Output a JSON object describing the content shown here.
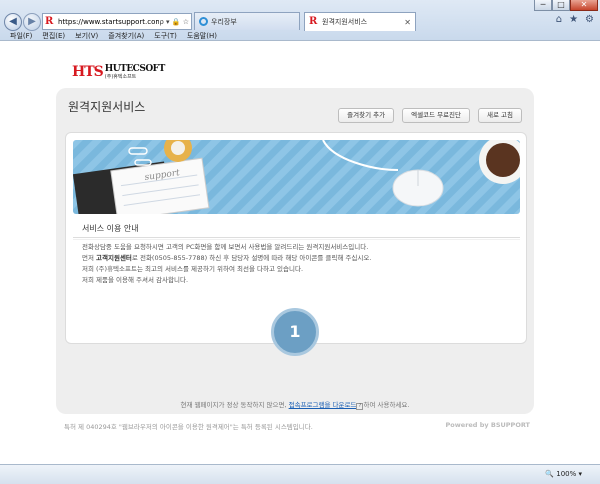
{
  "browser": {
    "window_buttons": {
      "minimize": "─",
      "maximize": "□",
      "close": "✕"
    },
    "back_icon": "back-arrow-icon",
    "forward_icon": "forward-arrow-icon",
    "address": "https://www.startsupport.com",
    "address_icons": "ρ ▾ 🔒 ☆",
    "tabs": [
      {
        "label": "우리장부",
        "active": false
      },
      {
        "label": "원격지원서비스",
        "active": true
      }
    ],
    "tab_close": "✕",
    "tool_icons": {
      "home": "⌂",
      "favorites": "★",
      "settings": "⚙"
    },
    "menu": [
      "파일(F)",
      "편집(E)",
      "보기(V)",
      "즐겨찾기(A)",
      "도구(T)",
      "도움말(H)"
    ],
    "zoom": "🔍 100%  ▾"
  },
  "page": {
    "logo": {
      "mark": "HTS",
      "name": "HUTECSOFT",
      "sub": "(주)휴텍소프트"
    },
    "title": "원격지원서비스",
    "buttons": [
      "즐겨찾기 추가",
      "엑셀코드 무료진단",
      "새로 고침"
    ],
    "banner_text": "support",
    "notice_title": "서비스 이용 안내",
    "notice_lines": [
      {
        "pre": "전화상담중 도움을 요청하시면 고객의 PC화면을 함께 보면서 사용법을 알려드리는 원격지원서비스입니다.",
        "bold": "",
        "post": ""
      },
      {
        "pre": "먼저 ",
        "bold": "고객지원센터",
        "post": "로 전화(0505-855-7788) 하신 후 담당자 설명에 따라 해당 아이콘를 클릭해 주십시오."
      },
      {
        "pre": "저희 (주)휴텍소프트는 최고의 서비스를 제공하기 위하여 최선을 다하고 있습니다.",
        "bold": "",
        "post": ""
      },
      {
        "pre": "저희 제품을 이용해 주셔서 감사합니다.",
        "bold": "",
        "post": ""
      }
    ],
    "session_number": "1",
    "footer": {
      "pre": "현재 웹페이지가 정상 동작하지 않으면, ",
      "link": "접속프로그램을 다운로드",
      "qmark": "?",
      "post": "하여 사용하세요."
    },
    "patent": "특허 제 040294호 \"웹브라우저의 아이콘을 이용한 원격제어\"는 특허 등록된 시스템입니다.",
    "powered": "Powered by BSUPPORT"
  },
  "colors": {
    "accent": "#6c9fc4",
    "banner": "#7ab8dd",
    "logo_red": "#d71920"
  }
}
